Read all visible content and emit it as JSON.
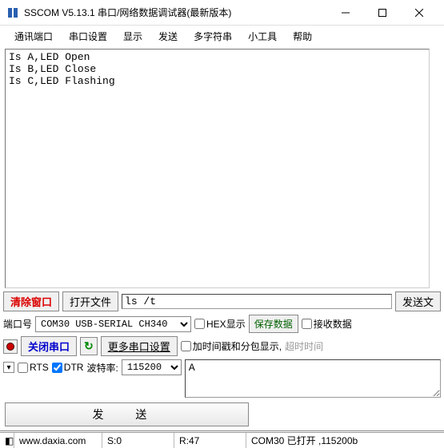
{
  "titlebar": {
    "title": "SSCOM V5.13.1 串口/网络数据调试器(最新版本)"
  },
  "menu": {
    "items": [
      "通讯端口",
      "串口设置",
      "显示",
      "发送",
      "多字符串",
      "小工具",
      "帮助"
    ]
  },
  "output": {
    "text": "Is A,LED Open\nIs B,LED Close\nIs C,LED Flashing"
  },
  "toolbar1": {
    "clear": "清除窗口",
    "openfile": "打开文件",
    "file_input": "ls /t",
    "sendfile": "发送文"
  },
  "row_port": {
    "port_label": "端口号",
    "port_value": "COM30 USB-SERIAL CH340",
    "hex_display": "HEX显示",
    "save_data": "保存数据",
    "recv_data": "接收数据"
  },
  "row_serial": {
    "close_serial": "关闭串口",
    "more_settings": "更多串口设置",
    "timestamp": "加时间戳和分包显示,",
    "timeout_label": "超时时间"
  },
  "row_opts": {
    "rts": "RTS",
    "dtr": "DTR",
    "baud_label": "波特率:",
    "baud_value": "115200",
    "input_value": "A"
  },
  "send": {
    "label": "发 送"
  },
  "status": {
    "url": "www.daxia.com",
    "s": "S:0",
    "r": "R:47",
    "conn": "COM30 已打开 ,115200b"
  }
}
